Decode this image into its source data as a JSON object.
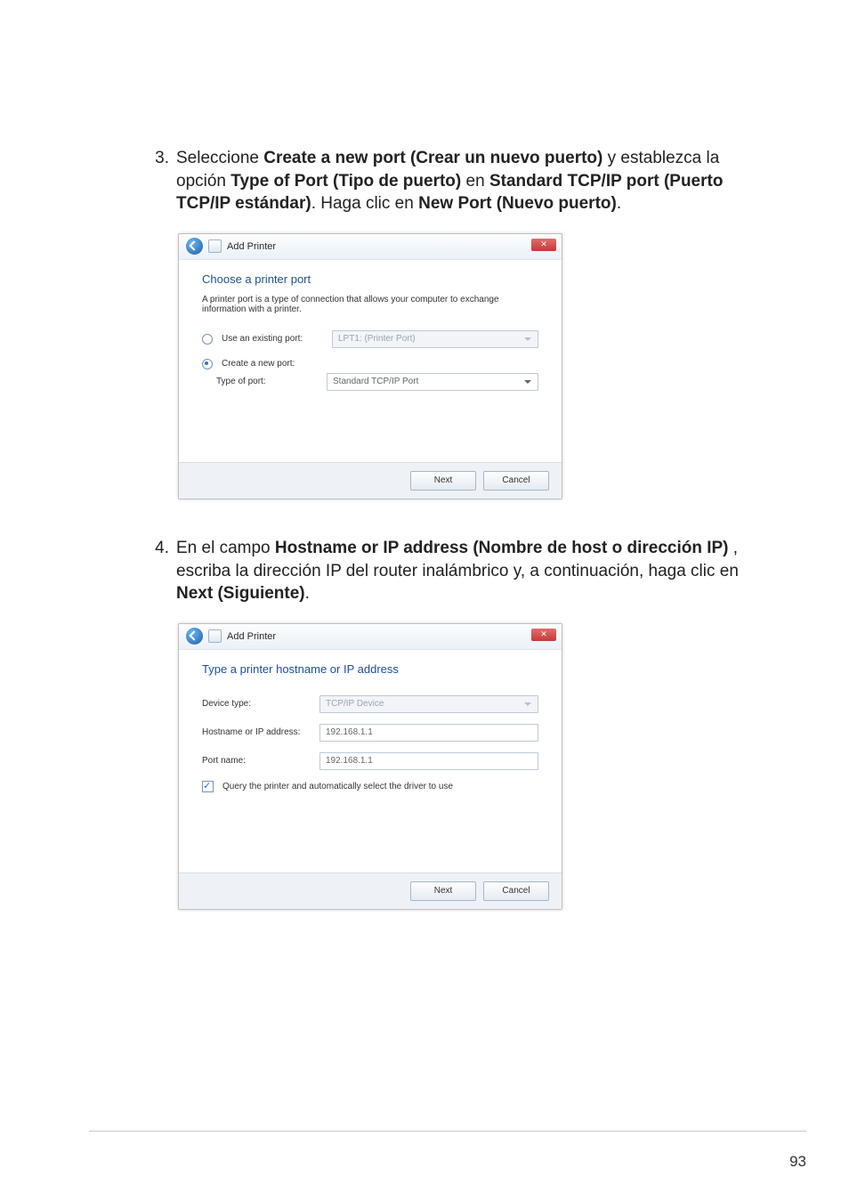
{
  "step3": {
    "num": "3.",
    "prefix": "Seleccione ",
    "bold1": "Create a new port (Crear un nuevo puerto)",
    "mid1": " y establezca la opción ",
    "bold2": "Type of Port (Tipo de puerto)",
    "mid2": " en ",
    "bold3": "Standard TCP/IP port (Puerto TCP/IP estándar)",
    "mid3": ". Haga clic en ",
    "bold4": "New Port (Nuevo puerto)",
    "suffix": "."
  },
  "step4": {
    "num": "4.",
    "prefix": "En el campo ",
    "bold1": "Hostname or IP address (Nombre de host o dirección IP)",
    "mid1": " , escriba la dirección IP del router inalámbrico y, a continuación, haga clic en ",
    "bold2": "Next (Siguiente)",
    "suffix": "."
  },
  "win1": {
    "title": "Add Printer",
    "heading": "Choose a printer port",
    "desc": "A printer port is a type of connection that allows your computer to exchange information with a printer.",
    "opt_existing": "Use an existing port:",
    "existing_val": "LPT1: (Printer Port)",
    "opt_create": "Create a new port:",
    "type_label": "Type of port:",
    "type_val": "Standard TCP/IP Port",
    "next": "Next",
    "cancel": "Cancel"
  },
  "win2": {
    "title": "Add Printer",
    "heading": "Type a printer hostname or IP address",
    "device_label": "Device type:",
    "device_val": "TCP/IP Device",
    "host_label": "Hostname or IP address:",
    "host_val": "192.168.1.1",
    "port_label": "Port name:",
    "port_val": "192.168.1.1",
    "query": "Query the printer and automatically select the driver to use",
    "next": "Next",
    "cancel": "Cancel"
  },
  "pagenum": "93"
}
